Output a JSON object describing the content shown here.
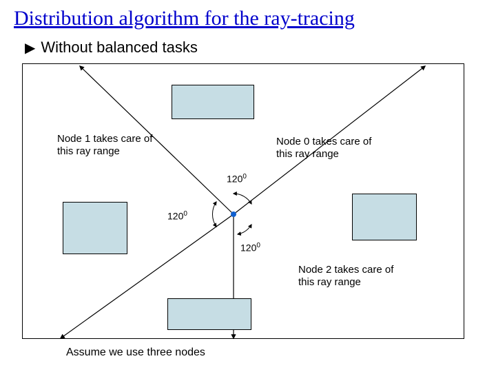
{
  "title": "Distribution algorithm for the ray-tracing",
  "bullet": "Without balanced tasks",
  "labels": {
    "node1": {
      "l1": "Node 1 takes care of",
      "l2": "this ray range"
    },
    "node0": {
      "l1": "Node 0 takes care of",
      "l2": "this ray range"
    },
    "node2": {
      "l1": "Node 2 takes care of",
      "l2": "this ray range"
    }
  },
  "angles": {
    "a1": "120",
    "a2": "120",
    "a3": "120"
  },
  "sup": "0",
  "caption": "Assume we use three nodes"
}
